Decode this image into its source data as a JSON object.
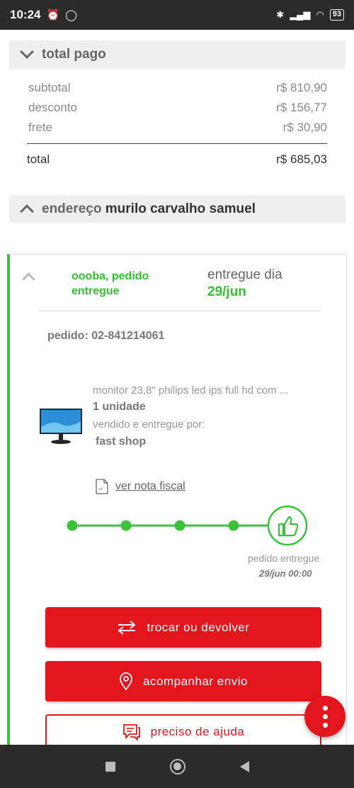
{
  "status_bar": {
    "time": "10:24",
    "battery": "93"
  },
  "summary": {
    "title": "total pago",
    "rows": [
      {
        "label": "subtotal",
        "value": "r$ 810,90"
      },
      {
        "label": "desconto",
        "value": "r$ 156,77"
      },
      {
        "label": "frete",
        "value": "r$ 30,90"
      }
    ],
    "total_label": "total",
    "total_value": "r$ 685,03"
  },
  "address": {
    "title": "endereço",
    "name": "murilo carvalho samuel"
  },
  "order": {
    "status_line1": "oooba, pedido",
    "status_line2": "entregue",
    "delivered_label": "entregue dia",
    "delivered_date": "29/jun",
    "order_number": "pedido: 02-841214061",
    "product_name": "monitor 23,8\" philips led ips full hd com ...",
    "quantity": "1 unidade",
    "sold_by_label": "vendido e entregue por:",
    "seller": "fast shop",
    "invoice_link": "ver nota fiscal",
    "tracking_status": "pedido entregue",
    "tracking_time": "29/jun 00:00",
    "progress_steps_completed": 5,
    "progress_steps_total": 5
  },
  "actions": {
    "exchange": "trocar ou devolver",
    "track": "acompanhar envio",
    "help": "preciso de ajuda"
  },
  "colors": {
    "accent_red": "#e3161d",
    "success_green": "#3cc13b"
  }
}
